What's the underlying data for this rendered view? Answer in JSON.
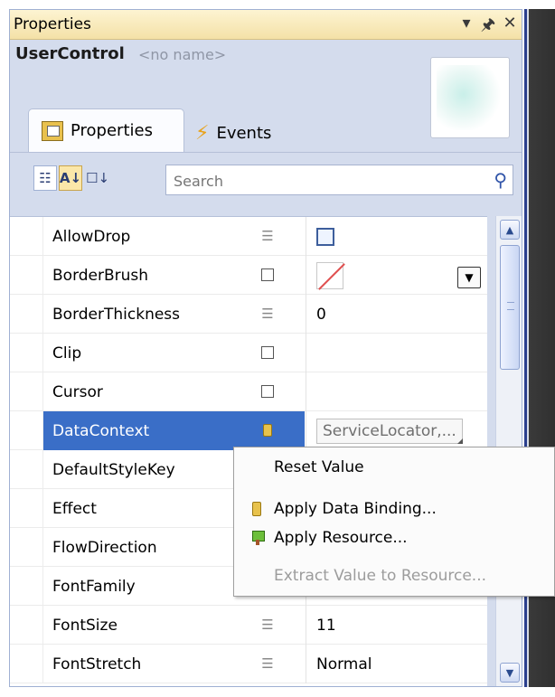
{
  "panel": {
    "title": "Properties",
    "controls": {
      "dropdown": "▾",
      "pin": "🖈",
      "close": "✕"
    }
  },
  "header": {
    "object_type": "UserControl",
    "object_name": "<no name>"
  },
  "tabs": [
    {
      "label": "Properties",
      "icon": "properties-icon",
      "selected": true
    },
    {
      "label": "Events",
      "icon": "lightning-icon",
      "selected": false
    }
  ],
  "toolbar": {
    "categorized_icon": "categorized-icon",
    "alpha_icon": "sort-alpha-icon",
    "source_icon": "sort-source-icon",
    "search_placeholder": "Search"
  },
  "properties": [
    {
      "name": "AllowDrop",
      "marker": "list",
      "value_type": "checkbox",
      "value": ""
    },
    {
      "name": "BorderBrush",
      "marker": "res",
      "value_type": "brush",
      "value": ""
    },
    {
      "name": "BorderThickness",
      "marker": "list",
      "value_type": "text",
      "value": "0"
    },
    {
      "name": "Clip",
      "marker": "res",
      "value_type": "text",
      "value": ""
    },
    {
      "name": "Cursor",
      "marker": "res",
      "value_type": "text",
      "value": ""
    },
    {
      "name": "DataContext",
      "marker": "db",
      "value_type": "binding",
      "value": "ServiceLocator,..."
    },
    {
      "name": "DefaultStyleKey",
      "marker": "",
      "value_type": "text",
      "value": ""
    },
    {
      "name": "Effect",
      "marker": "",
      "value_type": "text",
      "value": ""
    },
    {
      "name": "FlowDirection",
      "marker": "",
      "value_type": "text",
      "value": ""
    },
    {
      "name": "FontFamily",
      "marker": "",
      "value_type": "text",
      "value": ""
    },
    {
      "name": "FontSize",
      "marker": "list",
      "value_type": "text",
      "value": "11"
    },
    {
      "name": "FontStretch",
      "marker": "list",
      "value_type": "text",
      "value": "Normal"
    }
  ],
  "selected_property": "DataContext",
  "context_menu": {
    "items": [
      {
        "label": "Reset Value",
        "icon": "",
        "enabled": true
      },
      {
        "label": "Apply Data Binding...",
        "icon": "databinding-icon",
        "enabled": true
      },
      {
        "label": "Apply Resource...",
        "icon": "resource-icon",
        "enabled": true
      },
      {
        "label": "Extract Value to Resource...",
        "icon": "",
        "enabled": false
      }
    ]
  },
  "colors": {
    "selection": "#3a6ec7",
    "title_bar": "#f4e1a7",
    "panel_bg": "#d4dced"
  }
}
